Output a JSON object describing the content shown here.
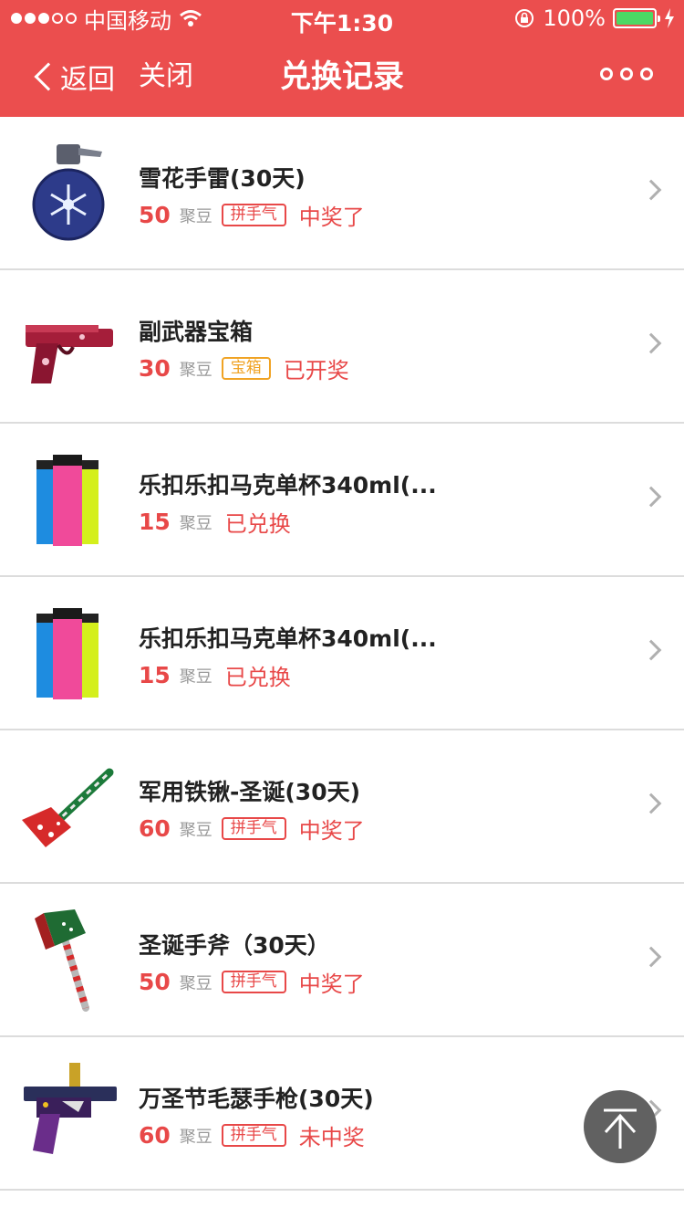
{
  "status_bar": {
    "carrier": "中国移动",
    "time": "下午1:30",
    "battery": "100%",
    "battery_level": 1.0
  },
  "nav": {
    "back_label": "返回",
    "close_label": "关闭",
    "title": "兑换记录"
  },
  "colors": {
    "brand": "#eb4e4e",
    "accent_red": "#e84848",
    "tag_gold": "#f0a324"
  },
  "items": [
    {
      "title": "雪花手雷(30天)",
      "price": "50",
      "unit": "聚豆",
      "tag": "拼手气",
      "status": "中奖了",
      "icon": "snowflake-grenade-icon"
    },
    {
      "title": "副武器宝箱",
      "price": "30",
      "unit": "聚豆",
      "tag": "宝箱",
      "status": "已开奖",
      "icon": "pistol-icon"
    },
    {
      "title": "乐扣乐扣马克单杯340ml(...",
      "price": "15",
      "unit": "聚豆",
      "tag": "",
      "status": "已兑换",
      "icon": "cups-icon"
    },
    {
      "title": "乐扣乐扣马克单杯340ml(...",
      "price": "15",
      "unit": "聚豆",
      "tag": "",
      "status": "已兑换",
      "icon": "cups-icon"
    },
    {
      "title": "军用铁锹-圣诞(30天)",
      "price": "60",
      "unit": "聚豆",
      "tag": "拼手气",
      "status": "中奖了",
      "icon": "shovel-icon"
    },
    {
      "title": "圣诞手斧（30天）",
      "price": "50",
      "unit": "聚豆",
      "tag": "拼手气",
      "status": "中奖了",
      "icon": "axe-icon"
    },
    {
      "title": "万圣节毛瑟手枪(30天)",
      "price": "60",
      "unit": "聚豆",
      "tag": "拼手气",
      "status": "未中奖",
      "icon": "mauser-pistol-icon"
    }
  ]
}
